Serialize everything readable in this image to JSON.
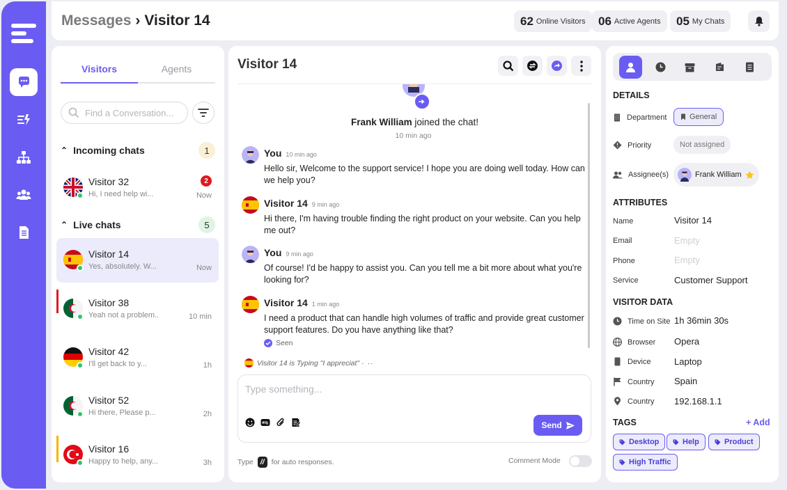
{
  "header": {
    "crumb_root": "Messages",
    "crumb_sep": "›",
    "crumb_current": "Visitor 14",
    "stats": [
      {
        "value": "62",
        "label": "Online Visitors"
      },
      {
        "value": "06",
        "label": "Active Agents"
      },
      {
        "value": "05",
        "label": "My Chats"
      }
    ]
  },
  "sidebar": {
    "tabs": [
      "Visitors",
      "Agents"
    ],
    "search_placeholder": "Find a Conversation...",
    "incoming": {
      "label": "Incoming chats",
      "count": "1"
    },
    "live": {
      "label": "Live chats",
      "count": "5"
    },
    "conversations": [
      {
        "name": "Visitor 32",
        "preview": "Hi, I need help wi...",
        "time": "Now",
        "badge": "2",
        "flag": "uk-flag-icon"
      },
      {
        "name": "Visitor 14",
        "preview": "Yes, absolutely. W...",
        "time": "Now",
        "flag": "spain-flag-icon"
      },
      {
        "name": "Visitor 38",
        "preview": "Yeah not a problem...",
        "time": "10 min",
        "flag": "algeria-flag-icon"
      },
      {
        "name": "Visitor 42",
        "preview": "I'll get back to y...",
        "time": "1h",
        "flag": "germany-flag-icon"
      },
      {
        "name": "Visitor 52",
        "preview": "Hi there, Please p...",
        "time": "2h",
        "flag": "algeria-flag-icon"
      },
      {
        "name": "Visitor 16",
        "preview": "Happy to help, any...",
        "time": "3h",
        "flag": "turkey-flag-icon"
      }
    ]
  },
  "chat": {
    "title": "Visitor 14",
    "join_name": "Frank William",
    "join_text": " joined the chat!",
    "join_time": "10 min ago",
    "messages": [
      {
        "who": "You",
        "when": "10 min ago",
        "text": "Hello sir, Welcome to the support service! I hope you are doing well today. How can we help you?"
      },
      {
        "who": "Visitor 14",
        "when": "9 min ago",
        "text": "Hi there, I'm having trouble finding the right product on your website. Can you help me out?"
      },
      {
        "who": "You",
        "when": "9 min ago",
        "text": "Of course! I'd be happy to assist you. Can you tell me a bit more about what you're looking for?"
      },
      {
        "who": "Visitor 14",
        "when": "1 min ago",
        "text": "I need a product that can handle high volumes of traffic and provide great customer support features. Do you have anything like that?"
      }
    ],
    "seen": "Seen",
    "typing": "Visitor 14 is Typing \"I appreciat\" ·",
    "compose_placeholder": "Type something...",
    "send_label": "Send",
    "footer_type": "Type",
    "footer_slash": "//",
    "footer_rest": "for auto responses.",
    "comment_mode": "Comment Mode"
  },
  "details": {
    "heading": "DETAILS",
    "department_label": "Department",
    "department_value": "General",
    "priority_label": "Priority",
    "priority_value": "Not assigned",
    "assignee_label": "Assignee(s)",
    "assignee_value": "Frank William",
    "attributes_heading": "ATTRIBUTES",
    "attributes": [
      {
        "label": "Name",
        "value": "Visitor 14",
        "empty": false
      },
      {
        "label": "Email",
        "value": "Empty",
        "empty": true
      },
      {
        "label": "Phone",
        "value": "Empty",
        "empty": true
      },
      {
        "label": "Service",
        "value": "Customer Support",
        "empty": false
      }
    ],
    "visitor_heading": "VISITOR DATA",
    "visitor": [
      {
        "label": "Time on Site",
        "value": "1h 36min 30s",
        "icon": "clock-icon"
      },
      {
        "label": "Browser",
        "value": "Opera",
        "icon": "globe-icon"
      },
      {
        "label": "Device",
        "value": "Laptop",
        "icon": "device-icon"
      },
      {
        "label": "Country",
        "value": "Spain",
        "icon": "flag-icon"
      },
      {
        "label": "Country",
        "value": "192.168.1.1",
        "icon": "location-icon"
      }
    ],
    "tags_heading": "TAGS",
    "add_label": "+ Add",
    "tags": [
      "Desktop",
      "Help",
      "Product",
      "High Traffic"
    ]
  },
  "colors": {
    "accent": "#6a5cf2",
    "online": "#2ec46a",
    "alert": "#e0191e"
  }
}
